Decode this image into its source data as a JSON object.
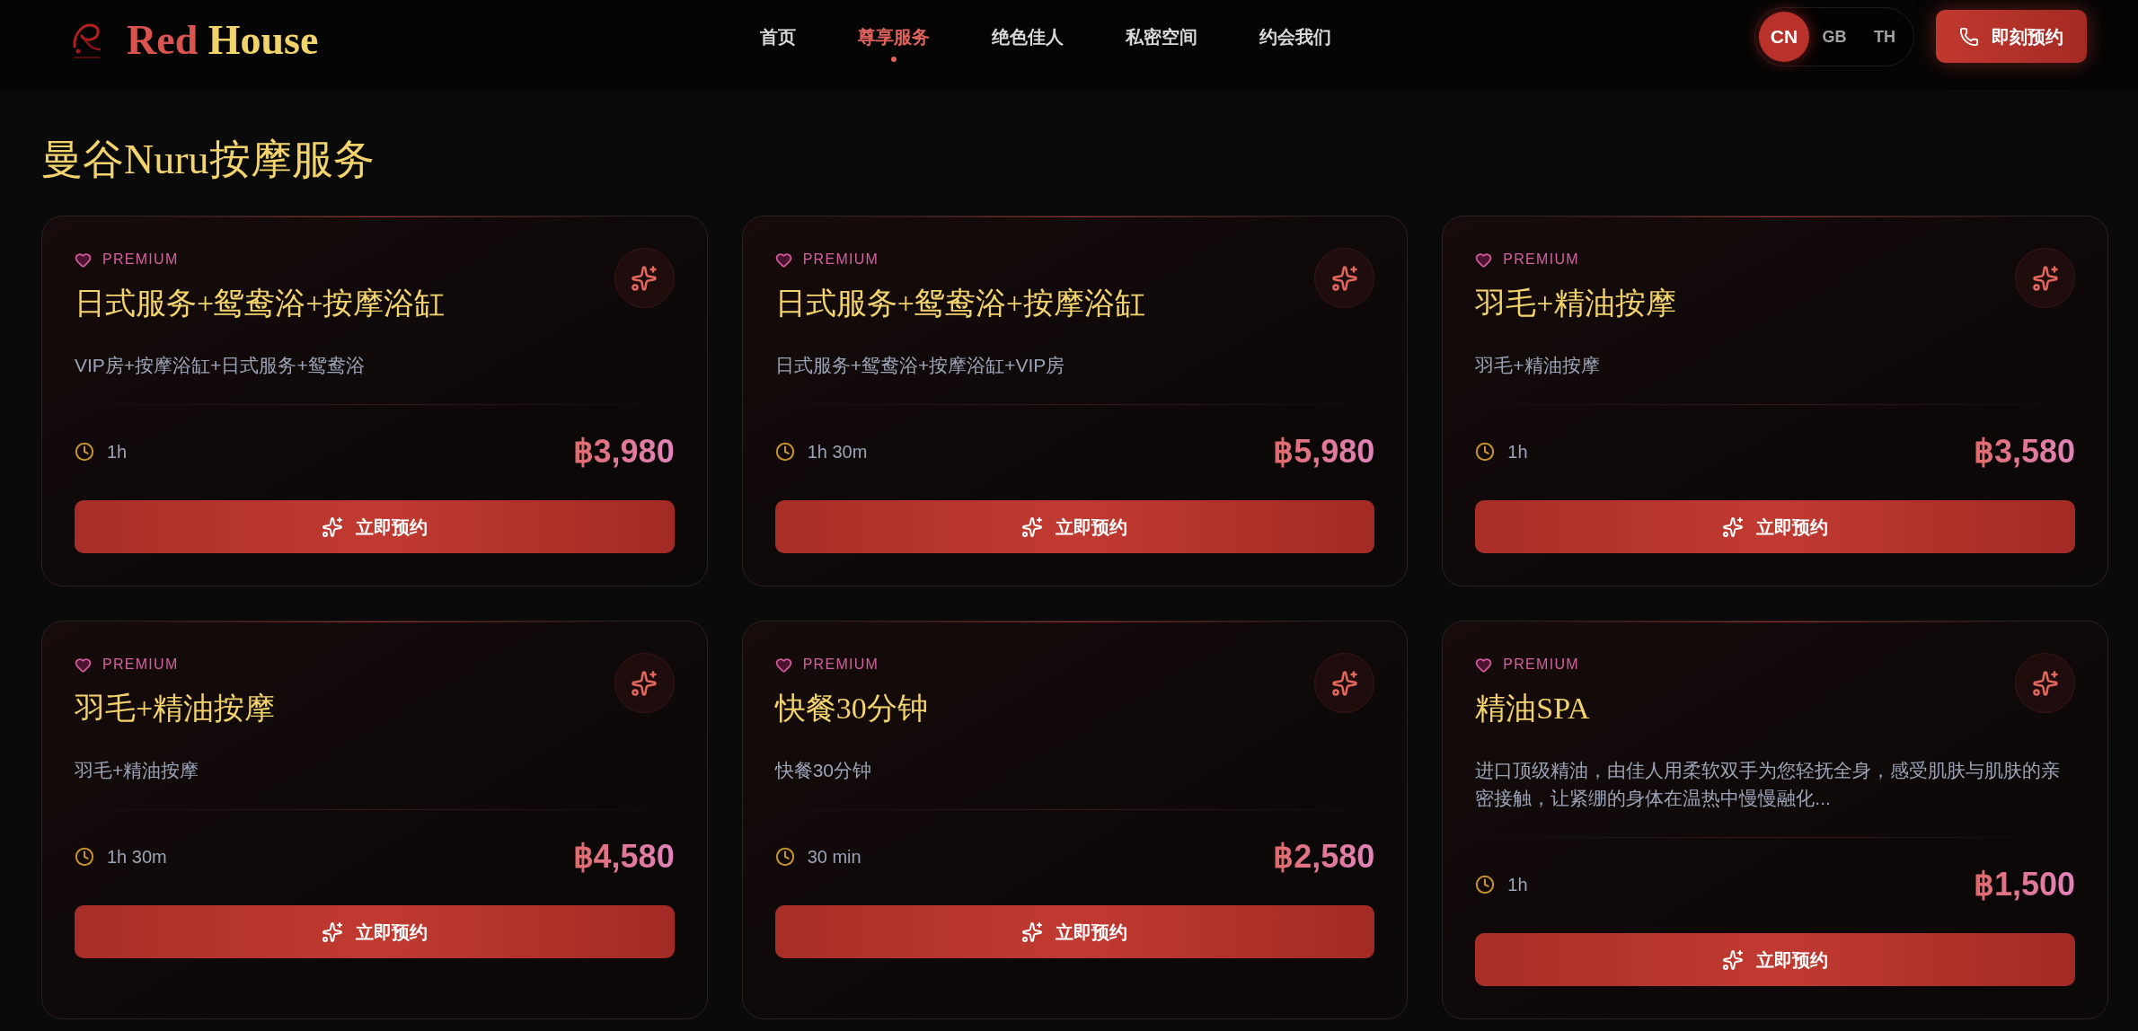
{
  "header": {
    "logo": {
      "primary": "Red",
      "secondary": "House"
    },
    "nav": [
      {
        "label": "首页",
        "selected": false
      },
      {
        "label": "尊享服务",
        "selected": true
      },
      {
        "label": "绝色佳人",
        "selected": false
      },
      {
        "label": "私密空间",
        "selected": false
      },
      {
        "label": "约会我们",
        "selected": false
      }
    ],
    "languages": [
      {
        "label": "CN",
        "selected": true
      },
      {
        "label": "GB",
        "selected": false
      },
      {
        "label": "TH",
        "selected": false
      }
    ],
    "book_button": "即刻预约"
  },
  "page_title": "曼谷Nuru按摩服务",
  "services": [
    {
      "tag": "PREMIUM",
      "title": "日式服务+鸳鸯浴+按摩浴缸",
      "description": "VIP房+按摩浴缸+日式服务+鸳鸯浴",
      "duration": "1h",
      "price": "฿3,980",
      "button": "立即预约"
    },
    {
      "tag": "PREMIUM",
      "title": "日式服务+鸳鸯浴+按摩浴缸",
      "description": "日式服务+鸳鸯浴+按摩浴缸+VIP房",
      "duration": "1h 30m",
      "price": "฿5,980",
      "button": "立即预约"
    },
    {
      "tag": "PREMIUM",
      "title": "羽毛+精油按摩",
      "description": "羽毛+精油按摩",
      "duration": "1h",
      "price": "฿3,580",
      "button": "立即预约"
    },
    {
      "tag": "PREMIUM",
      "title": "羽毛+精油按摩",
      "description": "羽毛+精油按摩",
      "duration": "1h 30m",
      "price": "฿4,580",
      "button": "立即预约"
    },
    {
      "tag": "PREMIUM",
      "title": "快餐30分钟",
      "description": "快餐30分钟",
      "duration": "30 min",
      "price": "฿2,580",
      "button": "立即预约"
    },
    {
      "tag": "PREMIUM",
      "title": "精油SPA",
      "description": "进口顶级精油，由佳人用柔软双手为您轻抚全身，感受肌肤与肌肤的亲密接触，让紧绷的身体在温热中慢慢融化...",
      "duration": "1h",
      "price": "฿1,500",
      "button": "立即预约"
    }
  ]
}
